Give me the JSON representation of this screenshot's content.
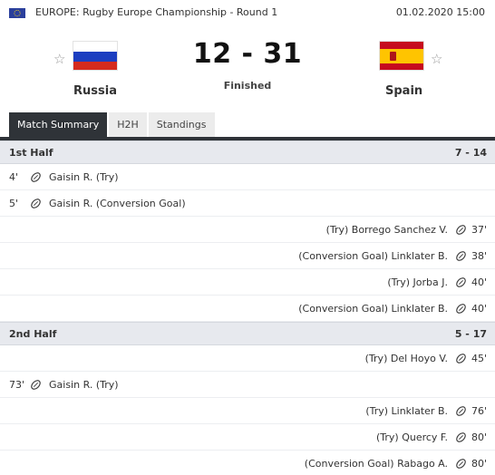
{
  "header": {
    "competition": "EUROPE: Rugby Europe Championship - Round 1",
    "date": "01.02.2020 15:00"
  },
  "home": {
    "name": "Russia"
  },
  "away": {
    "name": "Spain"
  },
  "score": "12 - 31",
  "status": "Finished",
  "tabs": [
    {
      "label": "Match Summary",
      "active": true
    },
    {
      "label": "H2H",
      "active": false
    },
    {
      "label": "Standings",
      "active": false
    }
  ],
  "halves": [
    {
      "label": "1st Half",
      "score": "7 - 14",
      "events": [
        {
          "side": "home",
          "minute": "4'",
          "text": "Gaisin R. (Try)"
        },
        {
          "side": "home",
          "minute": "5'",
          "text": "Gaisin R. (Conversion Goal)"
        },
        {
          "side": "away",
          "minute": "37'",
          "text": "(Try) Borrego Sanchez V."
        },
        {
          "side": "away",
          "minute": "38'",
          "text": "(Conversion Goal) Linklater B."
        },
        {
          "side": "away",
          "minute": "40'",
          "text": "(Try) Jorba J."
        },
        {
          "side": "away",
          "minute": "40'",
          "text": "(Conversion Goal) Linklater B."
        }
      ]
    },
    {
      "label": "2nd Half",
      "score": "5 - 17",
      "events": [
        {
          "side": "away",
          "minute": "45'",
          "text": "(Try) Del Hoyo V."
        },
        {
          "side": "home",
          "minute": "73'",
          "text": "Gaisin R. (Try)"
        },
        {
          "side": "away",
          "minute": "76'",
          "text": "(Try) Linklater B."
        },
        {
          "side": "away",
          "minute": "80'",
          "text": "(Try) Quercy F."
        },
        {
          "side": "away",
          "minute": "80'",
          "text": "(Conversion Goal) Rabago A."
        }
      ]
    }
  ],
  "colors": {
    "tab_active": "#2f3338",
    "section_bg": "#e7e9ee"
  },
  "icons": {
    "star": "☆",
    "event": "rugby-ball-icon"
  }
}
